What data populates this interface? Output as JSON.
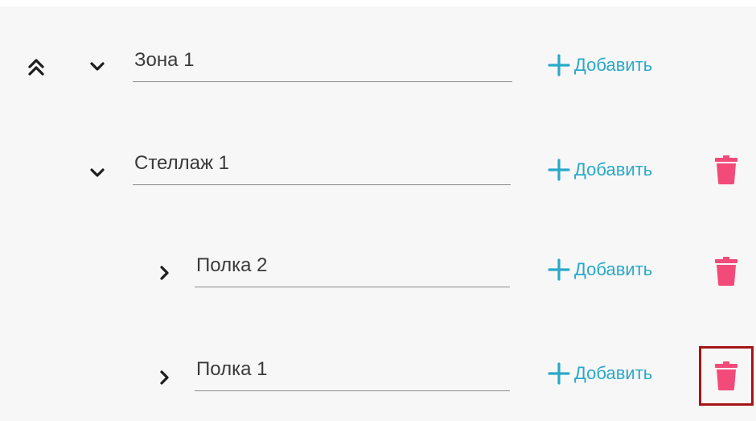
{
  "colors": {
    "accent": "#2aa9c8",
    "delete": "#f24b7a",
    "highlight": "#a51515"
  },
  "icons": {
    "collapse_all": "double-chevron-up-icon",
    "expanded": "chevron-down-icon",
    "collapsed": "chevron-right-icon",
    "add": "plus-icon",
    "delete": "trash-icon"
  },
  "tree": {
    "zone": {
      "name": "Зона 1",
      "add_label": "Добавить"
    },
    "rack": {
      "name": "Стеллаж 1",
      "add_label": "Добавить"
    },
    "shelves": [
      {
        "name": "Полка 2",
        "add_label": "Добавить"
      },
      {
        "name": "Полка 1",
        "add_label": "Добавить"
      }
    ]
  }
}
